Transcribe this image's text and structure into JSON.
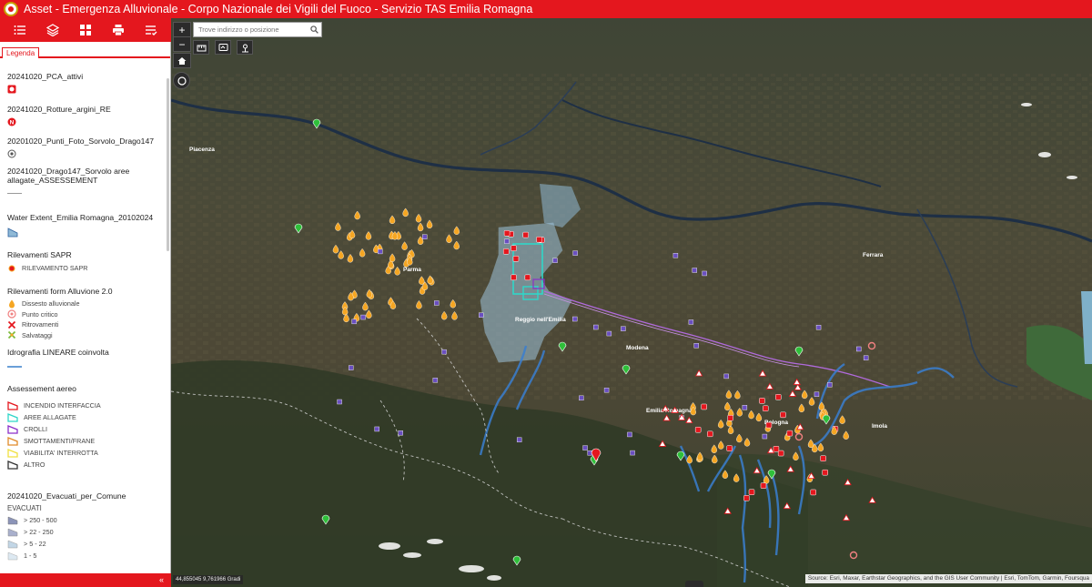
{
  "header": {
    "title": "Asset - Emergenza Alluvionale - Corpo Nazionale dei Vigili del Fuoco - Servizio TAS Emilia Romagna"
  },
  "toolbar": {
    "items": [
      {
        "name": "legend-list-button",
        "icon": "list-icon"
      },
      {
        "name": "layers-button",
        "icon": "layers-icon"
      },
      {
        "name": "basemap-gallery-button",
        "icon": "grid-icon"
      },
      {
        "name": "print-button",
        "icon": "printer-icon"
      },
      {
        "name": "layer-list-button",
        "icon": "checklist-icon"
      }
    ]
  },
  "panel": {
    "tab_legend": "Legenda",
    "layers": [
      {
        "title": "20241020_PCA_attivi"
      },
      {
        "title": "20241020_Rotture_argini_RE"
      },
      {
        "title": "20201020_Punti_Foto_Sorvolo_Drago147"
      },
      {
        "title": "20241020_Drago147_Sorvolo aree allagate_ASSESSEMENT"
      },
      {
        "title": "Water Extent_Emilia Romagna_20102024"
      },
      {
        "title": "Rilevamenti SAPR",
        "items": [
          "RILEVAMENTO SAPR"
        ]
      },
      {
        "title": "Rilevamenti form Alluvione 2.0",
        "items": [
          "Dissesto alluvionale",
          "Punto critico",
          "Ritrovamenti",
          "Salvataggi"
        ]
      },
      {
        "title": "Idrografia LINEARE coinvolta"
      },
      {
        "title": "Assessement aereo",
        "items": [
          "INCENDIO INTERFACCIA",
          "AREE ALLAGATE",
          "CROLLI",
          "SMOTTAMENTI/FRANE",
          "VIABILITA' INTERROTTA",
          "ALTRO"
        ]
      },
      {
        "title": "20241020_Evacuati_per_Comune",
        "subtitle": "EVACUATI",
        "items": [
          "> 250 - 500",
          "> 22 - 250",
          "> 5 - 22",
          "1 - 5"
        ]
      }
    ],
    "collapse_label": "«"
  },
  "map": {
    "search_placeholder": "Trove indirizzo o posizione",
    "zoom_in": "+",
    "zoom_out": "−",
    "coordinates": "44,855045 9,761966 Gradi",
    "attribution": "Source: Esri, Maxar, Earthstar Geographics, and the GIS User Community | Esri, TomTom, Garmin, Foursqua",
    "places": {
      "piacenza": "Piacenza",
      "parma": "Parma",
      "reggio": "Reggio nell'Emilia",
      "modena": "Modena",
      "bologna": "Bologna",
      "ferrara": "Ferrara",
      "emilia_romagna": "Emilia Romagna",
      "imola": "Imola"
    }
  },
  "colors": {
    "brand_red": "#e4171e",
    "water": "#8fb9d6",
    "assessment_cyan": "#2fd6c8",
    "flood_blue": "#3a7fd0"
  }
}
